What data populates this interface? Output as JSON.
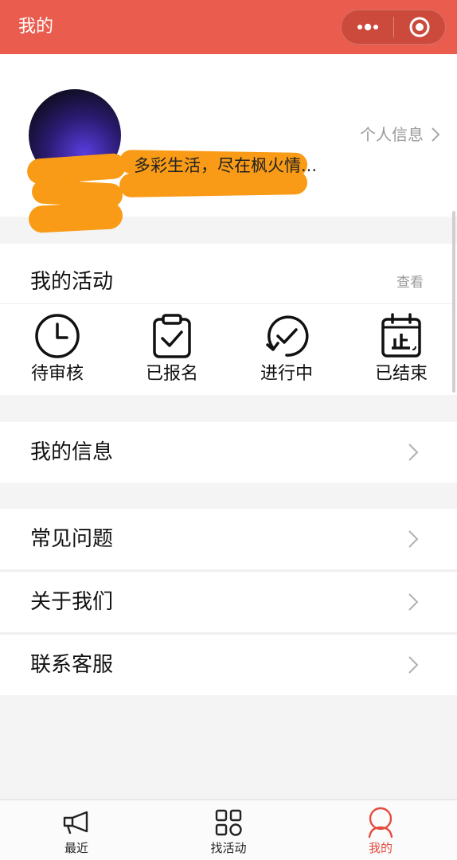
{
  "header": {
    "title": "我的",
    "more_icon": "more-dots-icon",
    "close_icon": "target-close-icon",
    "bg_color": "#e95c4e"
  },
  "profile": {
    "slogan": "多彩生活，尽在枫火情...",
    "info_link": "个人信息"
  },
  "activities": {
    "title": "我的活动",
    "view_label": "查看",
    "items": [
      {
        "label": "待审核",
        "icon": "clock-icon"
      },
      {
        "label": "已报名",
        "icon": "clipboard-check-icon"
      },
      {
        "label": "进行中",
        "icon": "refresh-check-icon"
      },
      {
        "label": "已结束",
        "icon": "calendar-stop-icon"
      }
    ]
  },
  "menu": [
    {
      "label": "我的信息"
    },
    {
      "label": "常见问题"
    },
    {
      "label": "关于我们"
    },
    {
      "label": "联系客服"
    }
  ],
  "tabbar": {
    "items": [
      {
        "label": "最近",
        "icon": "megaphone-icon",
        "active": false
      },
      {
        "label": "找活动",
        "icon": "grid-icon",
        "active": false
      },
      {
        "label": "我的",
        "icon": "person-icon",
        "active": true
      }
    ],
    "active_color": "#e44c3e"
  }
}
